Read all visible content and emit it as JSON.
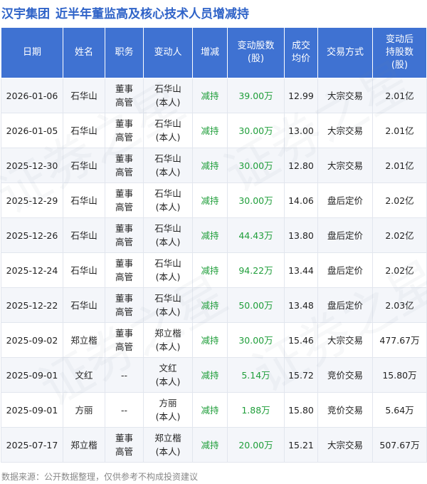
{
  "header": {
    "company": "汉宇集团",
    "title": "近半年董监高及核心技术人员增减持"
  },
  "table": {
    "columns": [
      [
        "日期"
      ],
      [
        "姓名"
      ],
      [
        "职务"
      ],
      [
        "变动人"
      ],
      [
        "增减"
      ],
      [
        "变动股数",
        "(股)"
      ],
      [
        "成交",
        "均价"
      ],
      [
        "交易方式"
      ],
      [
        "变动后",
        "持股数",
        "(股)"
      ]
    ],
    "rows": [
      {
        "date": "2026-01-06",
        "name": "石华山",
        "role": [
          "董事",
          "高管"
        ],
        "person": [
          "石华山",
          "(本人)"
        ],
        "change": "减持",
        "shares": "39.00万",
        "price": "12.99",
        "method": "大宗交易",
        "after": "2.01亿"
      },
      {
        "date": "2026-01-05",
        "name": "石华山",
        "role": [
          "董事",
          "高管"
        ],
        "person": [
          "石华山",
          "(本人)"
        ],
        "change": "减持",
        "shares": "30.00万",
        "price": "13.00",
        "method": "大宗交易",
        "after": "2.01亿"
      },
      {
        "date": "2025-12-30",
        "name": "石华山",
        "role": [
          "董事",
          "高管"
        ],
        "person": [
          "石华山",
          "(本人)"
        ],
        "change": "减持",
        "shares": "30.00万",
        "price": "12.80",
        "method": "大宗交易",
        "after": "2.01亿"
      },
      {
        "date": "2025-12-29",
        "name": "石华山",
        "role": [
          "董事",
          "高管"
        ],
        "person": [
          "石华山",
          "(本人)"
        ],
        "change": "减持",
        "shares": "30.00万",
        "price": "14.06",
        "method": "盘后定价",
        "after": "2.02亿"
      },
      {
        "date": "2025-12-26",
        "name": "石华山",
        "role": [
          "董事",
          "高管"
        ],
        "person": [
          "石华山",
          "(本人)"
        ],
        "change": "减持",
        "shares": "44.43万",
        "price": "13.80",
        "method": "盘后定价",
        "after": "2.02亿"
      },
      {
        "date": "2025-12-24",
        "name": "石华山",
        "role": [
          "董事",
          "高管"
        ],
        "person": [
          "石华山",
          "(本人)"
        ],
        "change": "减持",
        "shares": "94.22万",
        "price": "13.44",
        "method": "盘后定价",
        "after": "2.02亿"
      },
      {
        "date": "2025-12-22",
        "name": "石华山",
        "role": [
          "董事",
          "高管"
        ],
        "person": [
          "石华山",
          "(本人)"
        ],
        "change": "减持",
        "shares": "50.00万",
        "price": "13.48",
        "method": "盘后定价",
        "after": "2.03亿"
      },
      {
        "date": "2025-09-02",
        "name": "郑立楷",
        "role": [
          "董事",
          "高管"
        ],
        "person": [
          "郑立楷",
          "(本人)"
        ],
        "change": "减持",
        "shares": "30.00万",
        "price": "15.46",
        "method": "大宗交易",
        "after": "477.67万"
      },
      {
        "date": "2025-09-01",
        "name": "文红",
        "role": [
          "--"
        ],
        "person": [
          "文红",
          "(本人)"
        ],
        "change": "减持",
        "shares": "5.14万",
        "price": "15.72",
        "method": "竞价交易",
        "after": "15.80万"
      },
      {
        "date": "2025-09-01",
        "name": "方丽",
        "role": [
          "--"
        ],
        "person": [
          "方丽",
          "(本人)"
        ],
        "change": "减持",
        "shares": "1.88万",
        "price": "15.80",
        "method": "竞价交易",
        "after": "5.64万"
      },
      {
        "date": "2025-07-17",
        "name": "郑立楷",
        "role": [
          "董事",
          "高管"
        ],
        "person": [
          "郑立楷",
          "(本人)"
        ],
        "change": "减持",
        "shares": "20.00万",
        "price": "15.21",
        "method": "大宗交易",
        "after": "507.67万"
      }
    ]
  },
  "footer": {
    "text": "数据来源：公开数据整理，仅供参考不构成投资建议"
  },
  "colors": {
    "header_bg": "#3f72d2",
    "title": "#2f63c8",
    "decrease": "#1f9e3a"
  }
}
